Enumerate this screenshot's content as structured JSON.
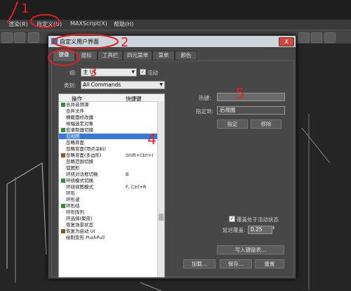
{
  "menubar": {
    "items": [
      "渲染(R)",
      "自定义(U)",
      "MAXScript(X)",
      "帮助(H)"
    ]
  },
  "dialog": {
    "title": "自定义用户界面",
    "close_label": "X",
    "tabs": [
      "键盘",
      "鼠标",
      "工具栏",
      "四元菜单",
      "菜单",
      "颜色"
    ],
    "group_label": "组:",
    "group_value": "主 UI",
    "active_label": "活动",
    "category_label": "类别:",
    "category_value": "All Commands",
    "list_headers": {
      "action": "操作",
      "shortcut": "快捷键"
    },
    "rows": [
      {
        "label": "合并音频源",
        "shortcut": ""
      },
      {
        "label": "合并文件",
        "shortcut": ""
      },
      {
        "label": "横截面修改器",
        "shortcut": ""
      },
      {
        "label": "候幅选定对象",
        "shortcut": ""
      },
      {
        "label": "宏录制器切换",
        "shortcut": ""
      },
      {
        "label": "后视图",
        "shortcut": ""
      },
      {
        "label": "忽略背面",
        "shortcut": ""
      },
      {
        "label": "忽略背面(顶点涂料)",
        "shortcut": ""
      },
      {
        "label": "忽略背面(多边形)",
        "shortcut": "Shift+Ctrl+I"
      },
      {
        "label": "忽略范围切换",
        "shortcut": ""
      },
      {
        "label": "弧图形",
        "shortcut": ""
      },
      {
        "label": "环绕对话框切换",
        "shortcut": "B"
      },
      {
        "label": "环绕模式切换",
        "shortcut": ""
      },
      {
        "label": "环绕视图模式",
        "shortcut": "F, Ctrl+R"
      },
      {
        "label": "环形",
        "shortcut": ""
      },
      {
        "label": "环形波",
        "shortcut": ""
      },
      {
        "label": "环形结",
        "shortcut": ""
      },
      {
        "label": "环形阵列",
        "shortcut": ""
      },
      {
        "label": "环选择(聚皮)",
        "shortcut": ""
      },
      {
        "label": "恢复场景状态",
        "shortcut": ""
      },
      {
        "label": "恢复为启动 UI",
        "shortcut": ""
      },
      {
        "label": "绘制变形 PushPull",
        "shortcut": ""
      }
    ],
    "selected_index": 5,
    "hotkey_label": "热键:",
    "assigned_label": "指定到:",
    "assigned_value": "后视图",
    "assign_button": "指定",
    "remove_button": "移除",
    "override_label": "覆盖处于活动状态",
    "delay_label": "延迟覆盖:",
    "delay_value": "0.25",
    "write_button": "写入键盘表...",
    "load_button": "加载...",
    "save_button": "保存...",
    "reset_button": "重置"
  },
  "annotations": [
    "1",
    "2",
    "3",
    "4",
    "5"
  ],
  "colors": {
    "annotation": "#e02020",
    "selection": "#3a78d4"
  }
}
